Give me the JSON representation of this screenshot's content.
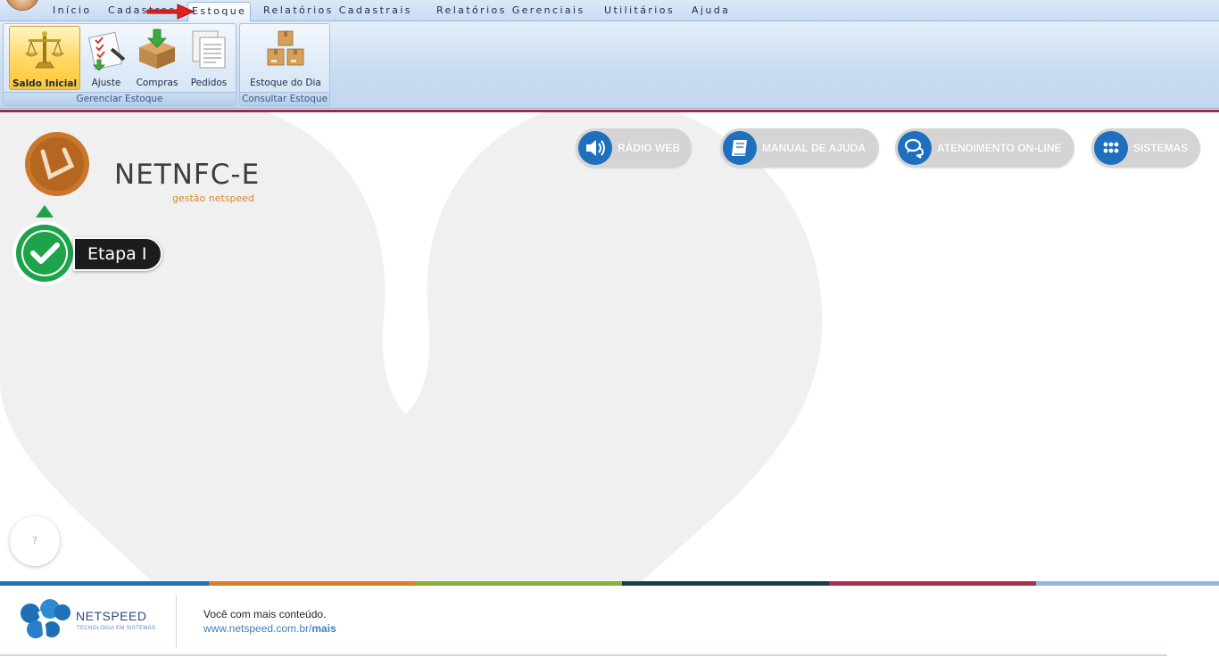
{
  "menu": {
    "tabs": [
      {
        "label": "Início"
      },
      {
        "label": "Cadastros"
      },
      {
        "label": "Estoque",
        "active": true
      },
      {
        "label": "Relatórios Cadastrais"
      },
      {
        "label": "Relatórios Gerenciais"
      },
      {
        "label": "Utilitários"
      },
      {
        "label": "Ajuda"
      }
    ]
  },
  "ribbon": {
    "groups": [
      {
        "label": "Gerenciar Estoque",
        "buttons": [
          {
            "label": "Saldo Inicial",
            "icon": "scales-icon",
            "selected": true
          },
          {
            "label": "Ajuste",
            "icon": "checklist-icon"
          },
          {
            "label": "Compras",
            "icon": "box-download-icon"
          },
          {
            "label": "Pedidos",
            "icon": "documents-icon"
          }
        ]
      },
      {
        "label": "Consultar Estoque",
        "buttons": [
          {
            "label": "Estoque do Dia",
            "icon": "stacked-boxes-icon"
          }
        ]
      }
    ]
  },
  "annotation": {
    "step_label": "Etapa I"
  },
  "brand": {
    "product": "NETNFC-E",
    "tagline": "gestão netspeed"
  },
  "actions": [
    {
      "label": "RÁDIO WEB",
      "icon": "speaker-icon"
    },
    {
      "label": "MANUAL DE AJUDA",
      "icon": "book-icon"
    },
    {
      "label": "ATENDIMENTO ON-LINE",
      "icon": "chat-icon"
    },
    {
      "label": "SISTEMAS",
      "icon": "grid-dots-icon"
    }
  ],
  "help": {
    "label": "?"
  },
  "colors": {
    "accent": "#9c2a44",
    "action_button_bg": "#d4d4d4",
    "action_icon_bg": "#1e6fbd",
    "colorbar": [
      "#1f71b8",
      "#d97f27",
      "#8db03d",
      "#173e4c",
      "#a8304a",
      "#8fb7df"
    ]
  },
  "footer": {
    "company": "NETSPEED",
    "company_tagline": "TECNOLOGIA EM SISTEMAS",
    "text": "Você com mais conteúdo.",
    "link_prefix": "www.netspeed.com.br/",
    "link_bold": "mais"
  }
}
